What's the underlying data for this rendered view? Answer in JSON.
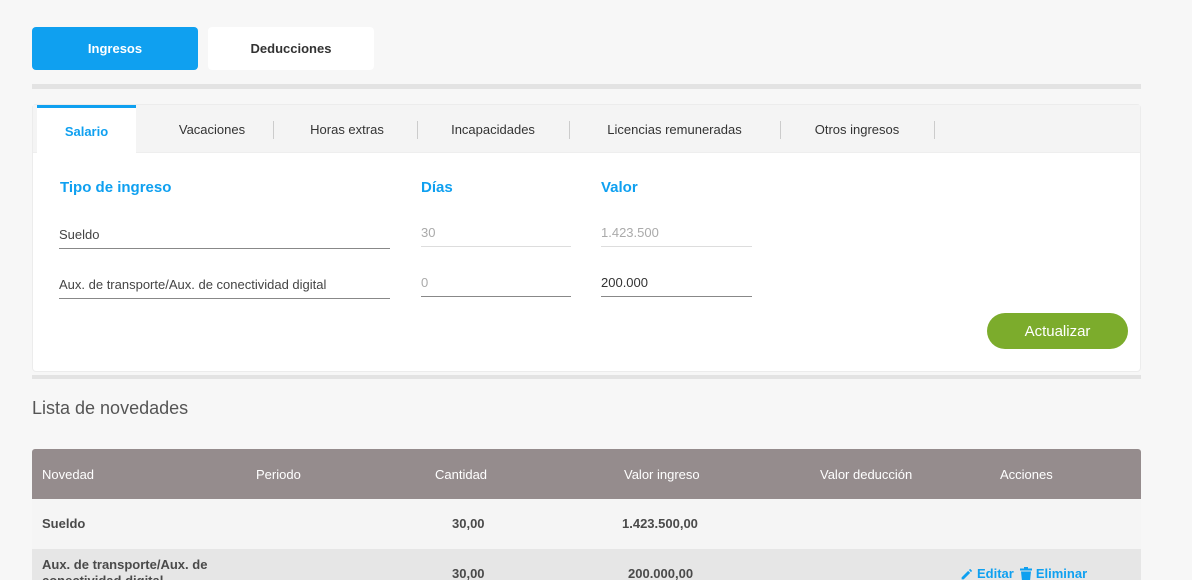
{
  "top_tabs": [
    {
      "label": "Ingresos"
    },
    {
      "label": "Deducciones"
    }
  ],
  "sub_tabs": [
    {
      "label": "Salario"
    },
    {
      "label": "Vacaciones"
    },
    {
      "label": "Horas extras"
    },
    {
      "label": "Incapacidades"
    },
    {
      "label": "Licencias remuneradas"
    },
    {
      "label": "Otros ingresos"
    }
  ],
  "form": {
    "headers": {
      "tipo": "Tipo de ingreso",
      "dias": "Días",
      "valor": "Valor"
    },
    "rows": [
      {
        "tipo": "Sueldo",
        "dias": "30",
        "valor": "1.423.500"
      },
      {
        "tipo": "Aux. de transporte/Aux. de conectividad digital",
        "dias": "0",
        "valor": "200.000"
      }
    ],
    "update_label": "Actualizar"
  },
  "list": {
    "title": "Lista de novedades",
    "columns": [
      "Novedad",
      "Periodo",
      "Cantidad",
      "Valor ingreso",
      "Valor deducción",
      "Acciones"
    ],
    "rows": [
      {
        "novedad": "Sueldo",
        "periodo": "",
        "cantidad": "30,00",
        "valor_ingreso": "1.423.500,00",
        "valor_deduccion": ""
      },
      {
        "novedad": "Aux. de transporte/Aux. de conectividad digital",
        "periodo": "",
        "cantidad": "30,00",
        "valor_ingreso": "200.000,00",
        "valor_deduccion": "",
        "edit_label": "Editar",
        "delete_label": "Eliminar"
      }
    ]
  },
  "colors": {
    "accent": "#0fa0f0",
    "button_green": "#7cac2c",
    "table_header": "#958c8d"
  }
}
